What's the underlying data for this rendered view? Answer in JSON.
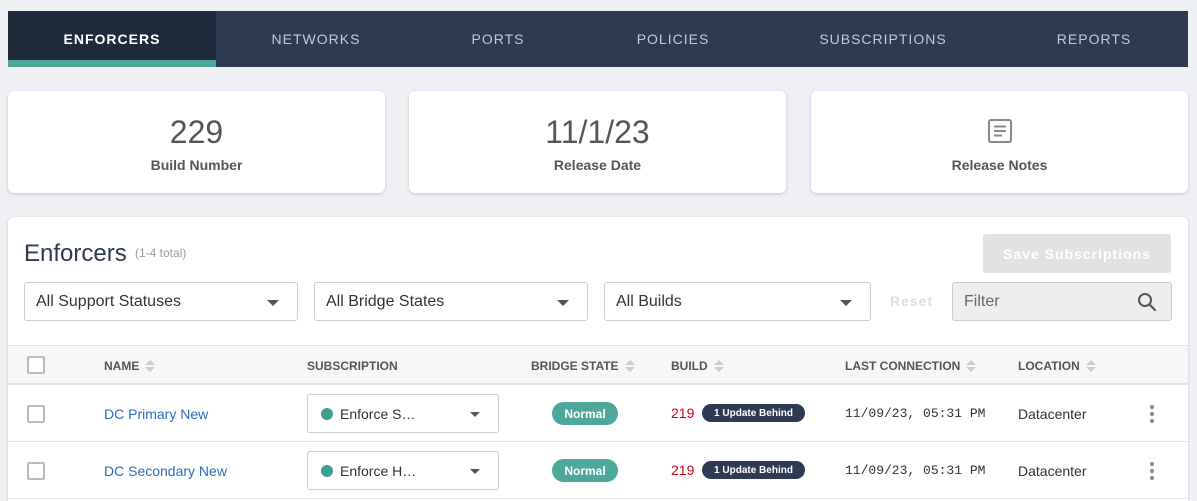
{
  "nav": {
    "tabs": [
      {
        "label": "ENFORCERS",
        "active": true
      },
      {
        "label": "NETWORKS",
        "active": false
      },
      {
        "label": "PORTS",
        "active": false
      },
      {
        "label": "POLICIES",
        "active": false
      },
      {
        "label": "SUBSCRIPTIONS",
        "active": false
      },
      {
        "label": "REPORTS",
        "active": false
      }
    ]
  },
  "cards": {
    "build": {
      "value": "229",
      "label": "Build Number"
    },
    "release": {
      "value": "11/1/23",
      "label": "Release Date"
    },
    "notes": {
      "icon": "document-icon",
      "label": "Release Notes"
    }
  },
  "panel": {
    "title": "Enforcers",
    "subtitle": "(1-4 total)",
    "save_label": "Save Subscriptions",
    "filters": {
      "support": "All Support Statuses",
      "bridge": "All Bridge States",
      "builds": "All Builds",
      "reset": "Reset",
      "search_placeholder": "Filter"
    }
  },
  "table": {
    "headers": {
      "name": "NAME",
      "subscription": "SUBSCRIPTION",
      "bridge_state": "BRIDGE STATE",
      "build": "BUILD",
      "last_connection": "LAST CONNECTION",
      "location": "LOCATION"
    },
    "rows": [
      {
        "name": "DC Primary New",
        "subscription": "Enforce S…",
        "bridge_state": "Normal",
        "build": "219",
        "build_badge": "1 Update Behind",
        "last_connection": "11/09/23, 05:31 PM",
        "location": "Datacenter"
      },
      {
        "name": "DC Secondary New",
        "subscription": "Enforce H…",
        "bridge_state": "Normal",
        "build": "219",
        "build_badge": "1 Update Behind",
        "last_connection": "11/09/23, 05:31 PM",
        "location": "Datacenter"
      }
    ]
  },
  "colors": {
    "nav_bg": "#2d3a52",
    "nav_active_bg": "#1e293b",
    "accent": "#4fa69a",
    "link": "#2b6cbf",
    "build_outdated": "#d0021b"
  }
}
